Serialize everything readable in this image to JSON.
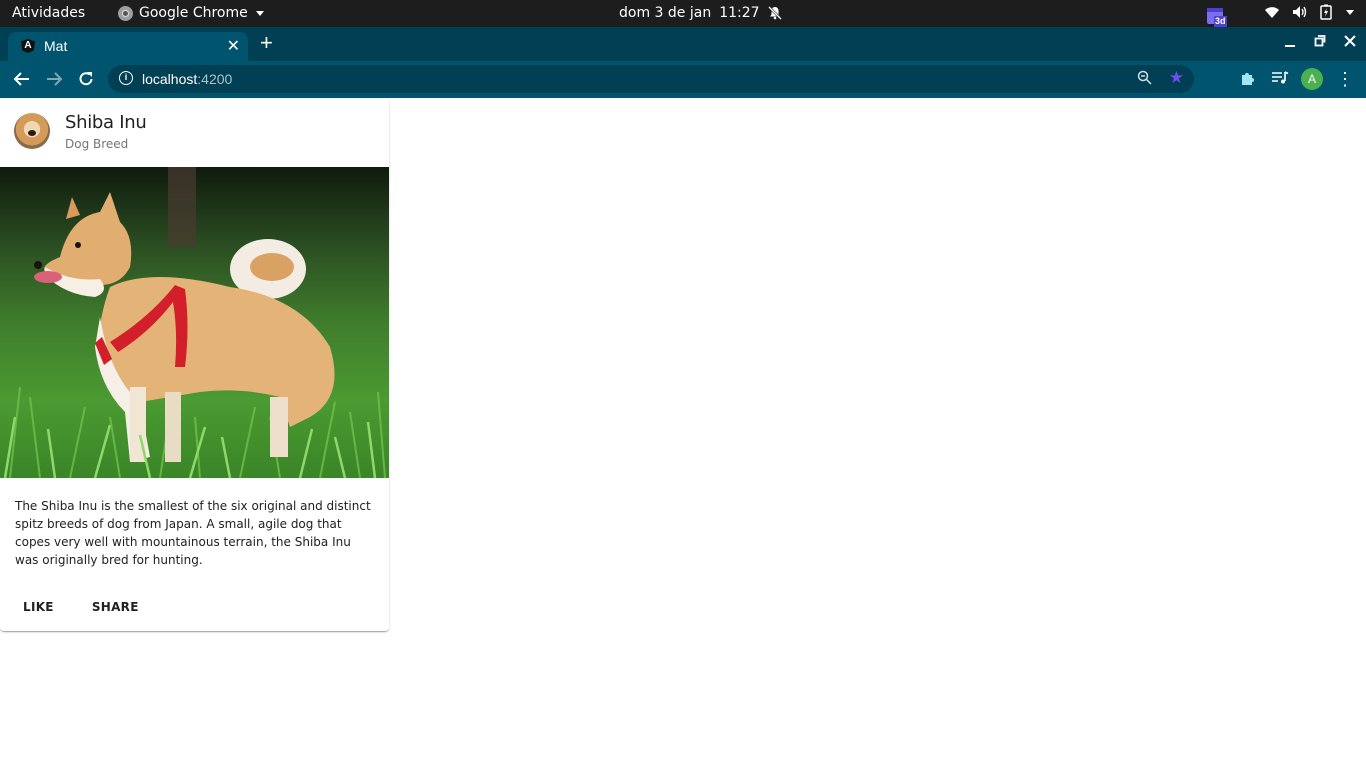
{
  "os_topbar": {
    "activities": "Atividades",
    "app_name": "Google Chrome",
    "date": "dom 3 de jan",
    "time": "11:27"
  },
  "browser": {
    "tab_title": "Mat",
    "url_host": "localhost",
    "url_port": ":4200",
    "extension_badge": "3d",
    "profile_initial": "A"
  },
  "card": {
    "title": "Shiba Inu",
    "subtitle": "Dog Breed",
    "content": "The Shiba Inu is the smallest of the six original and distinct spitz breeds of dog from Japan. A small, agile dog that copes very well with mountainous terrain, the Shiba Inu was originally bred for hunting.",
    "actions": [
      "LIKE",
      "SHARE"
    ]
  },
  "colors": {
    "topbar": "#1d1d1d",
    "tabstrip": "#003f54",
    "toolbar": "#00546e",
    "bookmark_star": "#6c4df2"
  }
}
